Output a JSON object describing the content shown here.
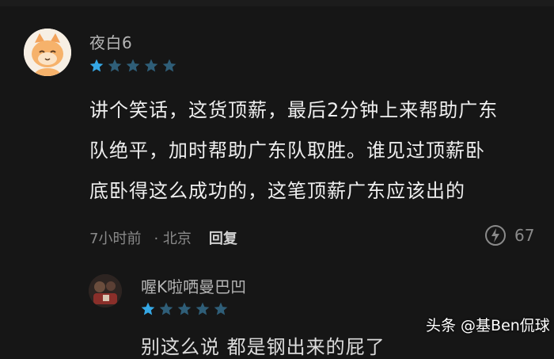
{
  "comment": {
    "username": "夜白6",
    "rating": 1,
    "max_rating": 5,
    "lines": [
      "讲个笑话，这货顶薪，最后2分钟上来帮助广东",
      "队绝平，加时帮助广东队取胜。谁见过顶薪卧",
      "底卧得这么成功的，这笔顶薪广东应该出的"
    ],
    "time": "7小时前",
    "location": "· 北京",
    "reply_label": "回复",
    "likes": "67"
  },
  "reply": {
    "username": "喔K啦哂曼巴凹",
    "rating": 1,
    "max_rating": 5,
    "partial_text": "别这么说 都是钢出来的屁了"
  },
  "watermark": "头条 @基Ben侃球",
  "colors": {
    "background": "#161616",
    "star_filled": "#35a8e6",
    "star_empty": "#2f5e78",
    "text_primary": "#eeeeee",
    "text_secondary": "#8a8a8a"
  }
}
